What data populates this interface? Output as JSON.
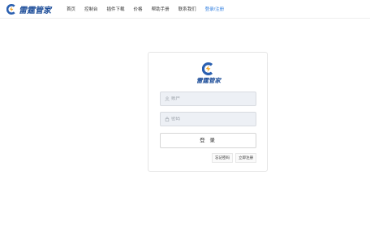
{
  "brand": {
    "name": "雷霆管家",
    "primary_color": "#1f4f9a",
    "accent_color": "#f5a623"
  },
  "nav": {
    "items": [
      {
        "label": "首页"
      },
      {
        "label": "控制台"
      },
      {
        "label": "插件下载"
      },
      {
        "label": "价格"
      },
      {
        "label": "帮助手册"
      },
      {
        "label": "联系我们"
      },
      {
        "label": "登录/注册",
        "active": true
      }
    ]
  },
  "login": {
    "logo_text": "雷霆管家",
    "username_placeholder": "账户",
    "username_value": "",
    "password_placeholder": "密码",
    "password_value": "",
    "submit_label": "登 录",
    "forgot_label": "忘记密码",
    "register_label": "立即注册"
  },
  "icons": {
    "username": "user-icon",
    "password": "lock-icon"
  }
}
